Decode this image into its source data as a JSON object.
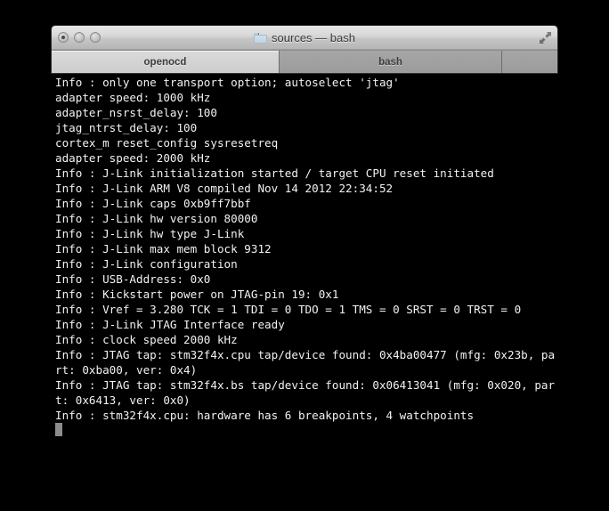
{
  "window": {
    "title": "sources — bash",
    "folder_icon": "folder-icon",
    "fullscreen_icon": "fullscreen-arrows-icon",
    "controls": [
      {
        "name": "close-button",
        "label": ""
      },
      {
        "name": "minimize-button",
        "label": ""
      },
      {
        "name": "zoom-button",
        "label": ""
      }
    ]
  },
  "tabs": [
    {
      "label": "openocd",
      "active": true
    },
    {
      "label": "bash",
      "active": false
    },
    {
      "label": "",
      "active": false
    }
  ],
  "terminal": {
    "cursor": "block-cursor",
    "lines": [
      "Info : only one transport option; autoselect 'jtag'",
      "adapter speed: 1000 kHz",
      "adapter_nsrst_delay: 100",
      "jtag_ntrst_delay: 100",
      "cortex_m reset_config sysresetreq",
      "adapter speed: 2000 kHz",
      "Info : J-Link initialization started / target CPU reset initiated",
      "Info : J-Link ARM V8 compiled Nov 14 2012 22:34:52",
      "Info : J-Link caps 0xb9ff7bbf",
      "Info : J-Link hw version 80000",
      "Info : J-Link hw type J-Link",
      "Info : J-Link max mem block 9312",
      "Info : J-Link configuration",
      "Info : USB-Address: 0x0",
      "Info : Kickstart power on JTAG-pin 19: 0x1",
      "Info : Vref = 3.280 TCK = 1 TDI = 0 TDO = 1 TMS = 0 SRST = 0 TRST = 0",
      "Info : J-Link JTAG Interface ready",
      "Info : clock speed 2000 kHz",
      "Info : JTAG tap: stm32f4x.cpu tap/device found: 0x4ba00477 (mfg: 0x23b, part: 0xba00, ver: 0x4)",
      "Info : JTAG tap: stm32f4x.bs tap/device found: 0x06413041 (mfg: 0x020, part: 0x6413, ver: 0x0)",
      "Info : stm32f4x.cpu: hardware has 6 breakpoints, 4 watchpoints"
    ]
  },
  "colors": {
    "terminal_background": "#000000",
    "terminal_foreground": "#f2f2f2",
    "cursor": "#8c8c8c",
    "titlebar_top": "#e8e8e8",
    "titlebar_bottom": "#b6b6b6",
    "tabbar": "#a0a0a0",
    "active_tab": "#d4d4d4"
  }
}
